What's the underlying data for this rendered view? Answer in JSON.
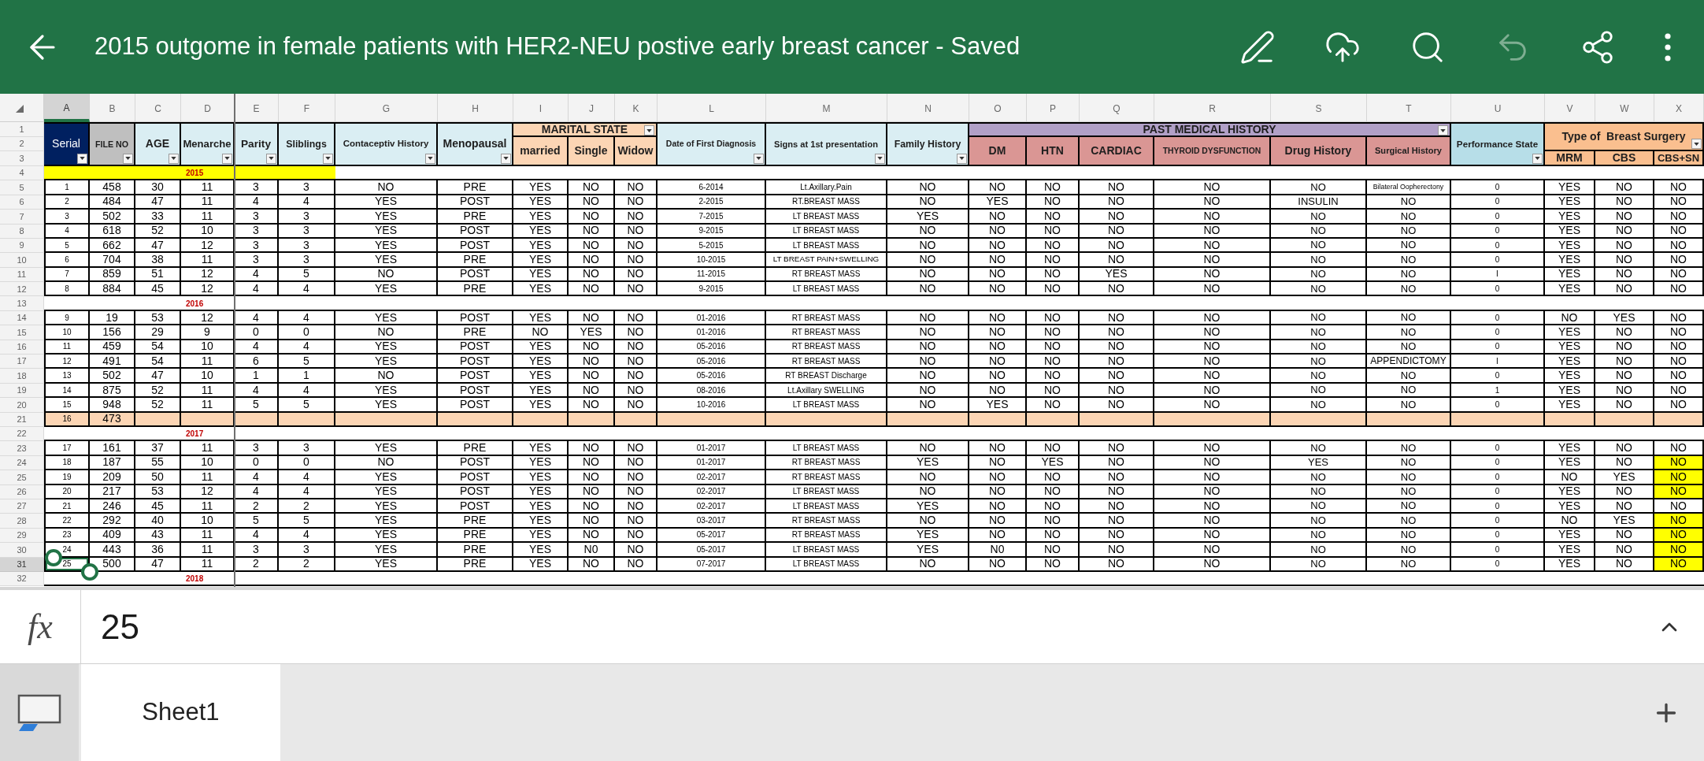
{
  "app_bar": {
    "title": "2015 outgome in female patients with HER2-NEU postive early breast cancer - Saved",
    "toolbar": [
      {
        "kind": "draw",
        "disabled": false
      },
      {
        "kind": "upload",
        "disabled": false
      },
      {
        "kind": "search",
        "disabled": false
      },
      {
        "kind": "undo",
        "disabled": true
      },
      {
        "kind": "share",
        "disabled": false
      },
      {
        "kind": "more",
        "disabled": false
      }
    ]
  },
  "column_headers": [
    {
      "label": "A",
      "selected": true
    },
    {
      "label": "B",
      "selected": false
    },
    {
      "label": "C",
      "selected": false
    },
    {
      "label": "D",
      "selected": false
    },
    {
      "label": "E",
      "selected": false
    },
    {
      "label": "F",
      "selected": false
    },
    {
      "label": "G",
      "selected": false
    },
    {
      "label": "H",
      "selected": false
    },
    {
      "label": "I",
      "selected": false
    },
    {
      "label": "J",
      "selected": false
    },
    {
      "label": "K",
      "selected": false
    },
    {
      "label": "L",
      "selected": false
    },
    {
      "label": "M",
      "selected": false
    },
    {
      "label": "N",
      "selected": false
    },
    {
      "label": "O",
      "selected": false
    },
    {
      "label": "P",
      "selected": false
    },
    {
      "label": "Q",
      "selected": false
    },
    {
      "label": "R",
      "selected": false
    },
    {
      "label": "S",
      "selected": false
    },
    {
      "label": "T",
      "selected": false
    },
    {
      "label": "U",
      "selected": false
    },
    {
      "label": "V",
      "selected": false
    },
    {
      "label": "W",
      "selected": false
    },
    {
      "label": "X",
      "selected": false
    }
  ],
  "header_rows": [
    {
      "number": "1",
      "selected": false
    },
    {
      "number": "2",
      "selected": false
    },
    {
      "number": "3",
      "selected": false
    }
  ],
  "header": [
    {
      "kind": "single",
      "label": "Serial",
      "color": "#002060",
      "filter": true
    },
    {
      "kind": "single",
      "label": "FILE NO",
      "color": "#bfbfbf",
      "filter": true
    },
    {
      "kind": "single",
      "label": "AGE",
      "color": "#daeef3",
      "filter": true
    },
    {
      "kind": "single",
      "label": "Menarche",
      "color": "#daeef3",
      "filter": true
    },
    {
      "kind": "single",
      "label": "Parity",
      "color": "#daeef3",
      "filter": true
    },
    {
      "kind": "single",
      "label": "Sliblings",
      "color": "#daeef3",
      "filter": true
    },
    {
      "kind": "single",
      "label": "Contaceptiv History",
      "color": "#daeef3",
      "filter": true
    },
    {
      "kind": "single",
      "label": "Menopausal",
      "color": "#daeef3",
      "filter": true
    },
    {
      "kind": "group",
      "label": "MARITAL STATE",
      "color": "#fcd5b4",
      "filter": true,
      "children": [
        {
          "label": "married",
          "color": "#fcd5b4"
        },
        {
          "label": "Single",
          "color": "#fcd5b4"
        },
        {
          "label": "Widow",
          "color": "#fcd5b4"
        }
      ]
    },
    {
      "kind": "single",
      "label": "Date of First Diagnosis",
      "color": "#daeef3",
      "filter": true
    },
    {
      "kind": "single",
      "label": "Signs at 1st presentation",
      "color": "#daeef3",
      "filter": true
    },
    {
      "kind": "single",
      "label": "Family History",
      "color": "#daeef3",
      "filter": true
    },
    {
      "kind": "group",
      "label": "PAST MEDICAL HISTORY",
      "color": "#b1a0c7",
      "filter": true,
      "children": [
        {
          "label": "DM",
          "color": "#da9694"
        },
        {
          "label": "HTN",
          "color": "#da9694"
        },
        {
          "label": "CARDIAC",
          "color": "#da9694"
        },
        {
          "label": "THYROID DYSFUNCTION",
          "color": "#da9694"
        },
        {
          "label": "Drug History",
          "color": "#da9694"
        },
        {
          "label": "Surgical History",
          "color": "#da9694"
        }
      ]
    },
    {
      "kind": "single",
      "label": "Performance State",
      "color": "#b7dee8",
      "filter": true
    },
    {
      "kind": "tall-group",
      "label": "Type of  Breast Surgery",
      "color": "#fabf8f",
      "filter": true,
      "children": [
        {
          "label": "MRM",
          "color": "#fabf8f"
        },
        {
          "label": "CBS",
          "color": "#fabf8f"
        },
        {
          "label": "CBS+SN",
          "color": "#fabf8f"
        }
      ]
    }
  ],
  "rows": [
    {
      "number": "4",
      "selected": false,
      "kind": "year",
      "label": "2015",
      "highlighted": true
    },
    {
      "number": "5",
      "selected": false,
      "kind": "data",
      "highlighted": false,
      "last_cell_highlighted": false,
      "cells": [
        "1",
        "458",
        "30",
        "11",
        "3",
        "3",
        "NO",
        "PRE",
        "YES",
        "NO",
        "NO",
        "6-2014",
        "Lt.Axillary.Pain",
        "NO",
        "NO",
        "NO",
        "NO",
        "NO",
        "NO",
        "Bilateral Oopherectony",
        "0",
        "YES",
        "NO",
        "NO"
      ]
    },
    {
      "number": "6",
      "selected": false,
      "kind": "data",
      "highlighted": false,
      "last_cell_highlighted": false,
      "cells": [
        "2",
        "484",
        "47",
        "11",
        "4",
        "4",
        "YES",
        "POST",
        "YES",
        "NO",
        "NO",
        "2-2015",
        "RT.BREAST MASS",
        "NO",
        "YES",
        "NO",
        "NO",
        "NO",
        "INSULIN",
        "NO",
        "0",
        "YES",
        "NO",
        "NO"
      ]
    },
    {
      "number": "7",
      "selected": false,
      "kind": "data",
      "highlighted": false,
      "last_cell_highlighted": false,
      "cells": [
        "3",
        "502",
        "33",
        "11",
        "3",
        "3",
        "YES",
        "PRE",
        "YES",
        "NO",
        "NO",
        "7-2015",
        "LT BREAST MASS",
        "YES",
        "NO",
        "NO",
        "NO",
        "NO",
        "NO",
        "NO",
        "0",
        "YES",
        "NO",
        "NO"
      ]
    },
    {
      "number": "8",
      "selected": false,
      "kind": "data",
      "highlighted": false,
      "last_cell_highlighted": false,
      "cells": [
        "4",
        "618",
        "52",
        "10",
        "3",
        "3",
        "YES",
        "POST",
        "YES",
        "NO",
        "NO",
        "9-2015",
        "LT BREAST MASS",
        "NO",
        "NO",
        "NO",
        "NO",
        "NO",
        "NO",
        "NO",
        "0",
        "YES",
        "NO",
        "NO"
      ]
    },
    {
      "number": "9",
      "selected": false,
      "kind": "data",
      "highlighted": false,
      "last_cell_highlighted": false,
      "cells": [
        "5",
        "662",
        "47",
        "12",
        "3",
        "3",
        "YES",
        "POST",
        "YES",
        "NO",
        "NO",
        "5-2015",
        "LT BREAST MASS",
        "NO",
        "NO",
        "NO",
        "NO",
        "NO",
        "NO",
        "NO",
        "0",
        "YES",
        "NO",
        "NO"
      ]
    },
    {
      "number": "10",
      "selected": false,
      "kind": "data",
      "highlighted": false,
      "last_cell_highlighted": false,
      "cells": [
        "6",
        "704",
        "38",
        "11",
        "3",
        "3",
        "YES",
        "PRE",
        "YES",
        "NO",
        "NO",
        "10-2015",
        "LT BREAST PAIN+SWELLING",
        "NO",
        "NO",
        "NO",
        "NO",
        "NO",
        "NO",
        "NO",
        "0",
        "YES",
        "NO",
        "NO"
      ]
    },
    {
      "number": "11",
      "selected": false,
      "kind": "data",
      "highlighted": false,
      "last_cell_highlighted": false,
      "cells": [
        "7",
        "859",
        "51",
        "12",
        "4",
        "5",
        "NO",
        "POST",
        "YES",
        "NO",
        "NO",
        "11-2015",
        "RT BREAST MASS",
        "NO",
        "NO",
        "NO",
        "YES",
        "NO",
        "NO",
        "NO",
        "I",
        "YES",
        "NO",
        "NO"
      ]
    },
    {
      "number": "12",
      "selected": false,
      "kind": "data",
      "highlighted": false,
      "last_cell_highlighted": false,
      "cells": [
        "8",
        "884",
        "45",
        "12",
        "4",
        "4",
        "YES",
        "PRE",
        "YES",
        "NO",
        "NO",
        "9-2015",
        "LT BREAST MASS",
        "NO",
        "NO",
        "NO",
        "NO",
        "NO",
        "NO",
        "NO",
        "0",
        "YES",
        "NO",
        "NO"
      ]
    },
    {
      "number": "13",
      "selected": false,
      "kind": "year",
      "label": "2016",
      "highlighted": false
    },
    {
      "number": "14",
      "selected": false,
      "kind": "data",
      "highlighted": false,
      "last_cell_highlighted": false,
      "cells": [
        "9",
        "19",
        "53",
        "12",
        "4",
        "4",
        "YES",
        "POST",
        "YES",
        "NO",
        "NO",
        "01-2016",
        "RT BREAST MASS",
        "NO",
        "NO",
        "NO",
        "NO",
        "NO",
        "NO",
        "NO",
        "0",
        "NO",
        "YES",
        "NO"
      ]
    },
    {
      "number": "15",
      "selected": false,
      "kind": "data",
      "highlighted": false,
      "last_cell_highlighted": false,
      "cells": [
        "10",
        "156",
        "29",
        "9",
        "0",
        "0",
        "NO",
        "PRE",
        "NO",
        "YES",
        "NO",
        "01-2016",
        "RT BREAST MASS",
        "NO",
        "NO",
        "NO",
        "NO",
        "NO",
        "NO",
        "NO",
        "0",
        "YES",
        "NO",
        "NO"
      ]
    },
    {
      "number": "16",
      "selected": false,
      "kind": "data",
      "highlighted": false,
      "last_cell_highlighted": false,
      "cells": [
        "11",
        "459",
        "54",
        "10",
        "4",
        "4",
        "YES",
        "POST",
        "YES",
        "NO",
        "NO",
        "05-2016",
        "RT BREAST MASS",
        "NO",
        "NO",
        "NO",
        "NO",
        "NO",
        "NO",
        "NO",
        "0",
        "YES",
        "NO",
        "NO"
      ]
    },
    {
      "number": "17",
      "selected": false,
      "kind": "data",
      "highlighted": false,
      "last_cell_highlighted": false,
      "cells": [
        "12",
        "491",
        "54",
        "11",
        "6",
        "5",
        "YES",
        "POST",
        "YES",
        "NO",
        "NO",
        "05-2016",
        "RT BREAST MASS",
        "NO",
        "NO",
        "NO",
        "NO",
        "NO",
        "NO",
        "APPENDICTOMY",
        "I",
        "YES",
        "NO",
        "NO"
      ]
    },
    {
      "number": "18",
      "selected": false,
      "kind": "data",
      "highlighted": false,
      "last_cell_highlighted": false,
      "cells": [
        "13",
        "502",
        "47",
        "10",
        "1",
        "1",
        "NO",
        "POST",
        "YES",
        "NO",
        "NO",
        "05-2016",
        "RT BREAST Discharge",
        "NO",
        "NO",
        "NO",
        "NO",
        "NO",
        "NO",
        "NO",
        "0",
        "YES",
        "NO",
        "NO"
      ]
    },
    {
      "number": "19",
      "selected": false,
      "kind": "data",
      "highlighted": false,
      "last_cell_highlighted": false,
      "cells": [
        "14",
        "875",
        "52",
        "11",
        "4",
        "4",
        "YES",
        "POST",
        "YES",
        "NO",
        "NO",
        "08-2016",
        "Lt.Axillary SWELLING",
        "NO",
        "NO",
        "NO",
        "NO",
        "NO",
        "NO",
        "NO",
        "1",
        "YES",
        "NO",
        "NO"
      ]
    },
    {
      "number": "20",
      "selected": false,
      "kind": "data",
      "highlighted": false,
      "last_cell_highlighted": false,
      "cells": [
        "15",
        "948",
        "52",
        "11",
        "5",
        "5",
        "YES",
        "POST",
        "YES",
        "NO",
        "NO",
        "10-2016",
        "LT BREAST MASS",
        "NO",
        "YES",
        "NO",
        "NO",
        "NO",
        "NO",
        "NO",
        "0",
        "YES",
        "NO",
        "NO"
      ]
    },
    {
      "number": "21",
      "selected": false,
      "kind": "data",
      "highlighted": true,
      "last_cell_highlighted": false,
      "cells": [
        "16",
        "473"
      ]
    },
    {
      "number": "22",
      "selected": false,
      "kind": "year",
      "label": "2017",
      "highlighted": false
    },
    {
      "number": "23",
      "selected": false,
      "kind": "data",
      "highlighted": false,
      "last_cell_highlighted": false,
      "cells": [
        "17",
        "161",
        "37",
        "11",
        "3",
        "3",
        "YES",
        "PRE",
        "YES",
        "NO",
        "NO",
        "01-2017",
        "LT BREAST MASS",
        "NO",
        "NO",
        "NO",
        "NO",
        "NO",
        "NO",
        "NO",
        "0",
        "YES",
        "NO",
        "NO"
      ]
    },
    {
      "number": "24",
      "selected": false,
      "kind": "data",
      "highlighted": false,
      "last_cell_highlighted": true,
      "cells": [
        "18",
        "187",
        "55",
        "10",
        "0",
        "0",
        "NO",
        "POST",
        "YES",
        "NO",
        "NO",
        "01-2017",
        "RT BREAST MASS",
        "YES",
        "NO",
        "YES",
        "NO",
        "NO",
        "YES",
        "NO",
        "0",
        "YES",
        "NO",
        "NO"
      ]
    },
    {
      "number": "25",
      "selected": false,
      "kind": "data",
      "highlighted": false,
      "last_cell_highlighted": true,
      "cells": [
        "19",
        "209",
        "50",
        "11",
        "4",
        "4",
        "YES",
        "POST",
        "YES",
        "NO",
        "NO",
        "02-2017",
        "RT BREAST MASS",
        "NO",
        "NO",
        "NO",
        "NO",
        "NO",
        "NO",
        "NO",
        "0",
        "NO",
        "YES",
        "NO"
      ]
    },
    {
      "number": "26",
      "selected": false,
      "kind": "data",
      "highlighted": false,
      "last_cell_highlighted": true,
      "cells": [
        "20",
        "217",
        "53",
        "12",
        "4",
        "4",
        "YES",
        "POST",
        "YES",
        "NO",
        "NO",
        "02-2017",
        "LT BREAST MASS",
        "NO",
        "NO",
        "NO",
        "NO",
        "NO",
        "NO",
        "NO",
        "0",
        "YES",
        "NO",
        "NO"
      ]
    },
    {
      "number": "27",
      "selected": false,
      "kind": "data",
      "highlighted": false,
      "last_cell_highlighted": false,
      "cells": [
        "21",
        "246",
        "45",
        "11",
        "2",
        "2",
        "YES",
        "POST",
        "YES",
        "NO",
        "NO",
        "02-2017",
        "LT BREAST MASS",
        "YES",
        "NO",
        "NO",
        "NO",
        "NO",
        "NO",
        "NO",
        "0",
        "YES",
        "NO",
        "NO"
      ]
    },
    {
      "number": "28",
      "selected": false,
      "kind": "data",
      "highlighted": false,
      "last_cell_highlighted": true,
      "cells": [
        "22",
        "292",
        "40",
        "10",
        "5",
        "5",
        "YES",
        "PRE",
        "YES",
        "NO",
        "NO",
        "03-2017",
        "RT BREAST MASS",
        "NO",
        "NO",
        "NO",
        "NO",
        "NO",
        "NO",
        "NO",
        "0",
        "NO",
        "YES",
        "NO"
      ]
    },
    {
      "number": "29",
      "selected": false,
      "kind": "data",
      "highlighted": false,
      "last_cell_highlighted": true,
      "cells": [
        "23",
        "409",
        "43",
        "11",
        "4",
        "4",
        "YES",
        "PRE",
        "YES",
        "NO",
        "NO",
        "05-2017",
        "RT BREAST MASS",
        "YES",
        "NO",
        "NO",
        "NO",
        "NO",
        "NO",
        "NO",
        "0",
        "YES",
        "NO",
        "NO"
      ]
    },
    {
      "number": "30",
      "selected": false,
      "kind": "data",
      "highlighted": false,
      "last_cell_highlighted": true,
      "cells": [
        "24",
        "443",
        "36",
        "11",
        "3",
        "3",
        "YES",
        "PRE",
        "YES",
        "N0",
        "NO",
        "05-2017",
        "LT BREAST MASS",
        "YES",
        "N0",
        "NO",
        "NO",
        "NO",
        "NO",
        "NO",
        "0",
        "YES",
        "NO",
        "NO"
      ]
    },
    {
      "number": "31",
      "selected": true,
      "kind": "data",
      "highlighted": false,
      "last_cell_highlighted": true,
      "cells": [
        "25",
        "500",
        "47",
        "11",
        "2",
        "2",
        "YES",
        "PRE",
        "YES",
        "NO",
        "NO",
        "07-2017",
        "LT BREAST MASS",
        "NO",
        "NO",
        "NO",
        "NO",
        "NO",
        "NO",
        "NO",
        "0",
        "YES",
        "NO",
        "NO"
      ]
    },
    {
      "number": "32",
      "selected": false,
      "kind": "year",
      "label": "2018",
      "highlighted": false
    }
  ],
  "formula_bar": {
    "label": "fx",
    "value": "25"
  },
  "sheet_tabs": [
    {
      "label": "Sheet1",
      "selected": true
    }
  ]
}
